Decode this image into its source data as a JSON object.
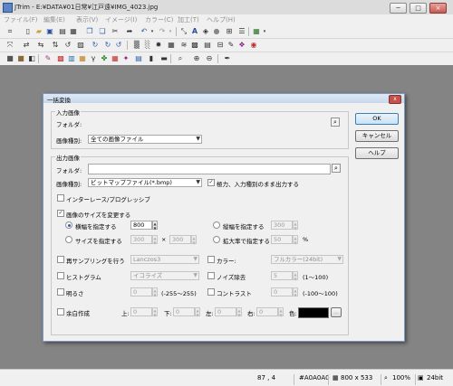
{
  "window": {
    "title": "JTrim - E:¥DATA¥01日常¥江戸遠¥IMG_4023.jpg"
  },
  "menu": [
    "ファイル(F)",
    "編集(E)",
    "表示(V)",
    "イメージ(I)",
    "カラー(C)",
    "加工(T)",
    "ヘルプ(H)"
  ],
  "toolbar1": [
    "crop-icon",
    "new-file-icon",
    "open-folder-icon",
    "save-icon",
    "print-icon",
    "preview-icon",
    "copy-icon",
    "paste-icon",
    "cut-icon",
    "redo-arrow-icon",
    "undo-icon",
    "undo-dropdown-icon",
    "redo-icon",
    "redo-dropdown-icon",
    "resize-icon",
    "text-icon",
    "stamp-icon",
    "circle-icon",
    "grid-view-icon",
    "list-view-icon",
    "color-icon",
    "color-dropdown-icon"
  ],
  "toolbar2": [
    "move-icon",
    "transform-icon",
    "flip-horizontal-icon",
    "flip-vertical-icon",
    "rotate-icon",
    "rotate-left-icon",
    "rotate-right-icon",
    "rotate-180-icon",
    "noise-icon",
    "sharpen-icon",
    "blur-icon",
    "emboss-icon",
    "mosaic-icon",
    "wave-icon",
    "glass-icon",
    "color-adjust-icon",
    "frame-icon",
    "brush-icon",
    "red-eye-icon"
  ],
  "toolbar3": [
    "grayscale-icon",
    "sepia-icon",
    "negative-icon",
    "palette-icon",
    "contrast-icon",
    "histogram-icon",
    "gradient-icon",
    "gamma-icon",
    "posterize-icon",
    "tone-icon",
    "swatch-icon",
    "halftone-icon",
    "zoom-dropdown-icon",
    "zoom-in-icon",
    "zoom-out-icon",
    "eyedropper-icon"
  ],
  "dialog": {
    "title": "一括変換",
    "close": "x",
    "input_group": "入力画像",
    "folder_label": "フォルダ:",
    "input_type_label": "画像種別:",
    "input_type": "全ての画像ファイル",
    "output_group": "出力画像",
    "output_folder_label": "フォルダ:",
    "output_type_label": "画像種別:",
    "output_type": "ビットマップファイル(*.bmp)",
    "keep_type": "極力、入力種別のまま出力する",
    "interlace": "インターレース/プログレッシブ",
    "resize": "画像のサイズを変更する",
    "width_radio": "横幅を指定する",
    "width_value": "800",
    "height_radio": "縦幅を指定する",
    "height_value": "300",
    "size_radio": "サイズを指定する",
    "size_w": "300",
    "size_x": "×",
    "size_h": "300",
    "scale_radio": "拡大率で指定する",
    "scale_value": "50",
    "scale_unit": "%",
    "resample": "再サンプリングを行う",
    "resample_method": "Lanczos3",
    "color": "カラー:",
    "color_value": "フルカラー(24bit)",
    "histogram": "ヒストグラム",
    "histogram_value": "イコライズ",
    "noise": "ノイズ除去",
    "noise_value": "5",
    "noise_range": "(1〜100)",
    "brightness": "明るさ",
    "brightness_value": "0",
    "brightness_range": "(-255〜255)",
    "contrast": "コントラスト",
    "contrast_value": "0",
    "contrast_range": "(-100〜100)",
    "margin": "余白作成",
    "top_label": "上:",
    "top_value": "0",
    "bottom_label": "下:",
    "bottom_value": "0",
    "left_label": "左:",
    "left_value": "0",
    "right_label": "右:",
    "right_value": "0",
    "color_label": "色:",
    "color_btn": "..",
    "ok": "OK",
    "cancel": "キャンセル",
    "help": "ヘルプ"
  },
  "status": {
    "coords": "87 , 4",
    "color_code": "#A0A0A0",
    "dimensions": "800 x 533",
    "zoom": "100%",
    "depth": "24bit"
  },
  "colors": {
    "margin_color": "#000000",
    "workspace": "#848484"
  }
}
